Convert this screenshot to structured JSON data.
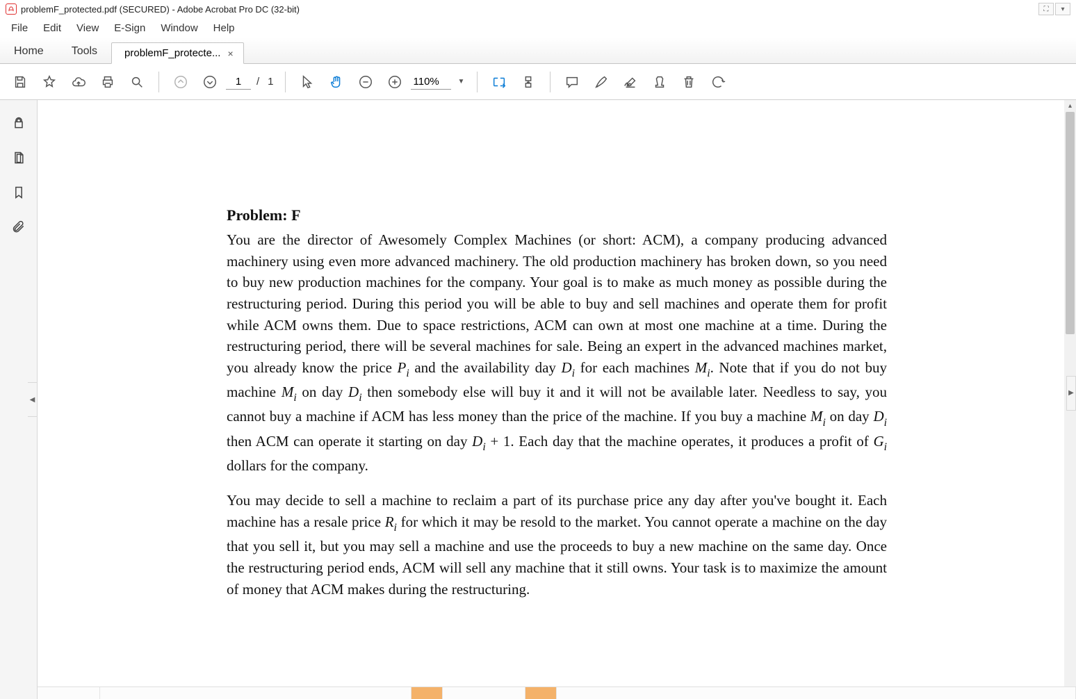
{
  "window": {
    "title": "problemF_protected.pdf (SECURED) - Adobe Acrobat Pro DC (32-bit)"
  },
  "menu": {
    "file": "File",
    "edit": "Edit",
    "view": "View",
    "esign": "E-Sign",
    "window": "Window",
    "help": "Help"
  },
  "tabs": {
    "home": "Home",
    "tools": "Tools",
    "doc": "problemF_protecte...",
    "close": "×"
  },
  "toolbar": {
    "page_current": "1",
    "page_sep": "/",
    "page_total": "1",
    "zoom_value": "110%"
  },
  "document": {
    "heading": "Problem: F",
    "para1_pre": "You are the director of Awesomely Complex Machines (or short: ACM), a company producing advanced machinery using even more advanced machinery. The old production machinery has broken down, so you need to buy new production machines for the company. Your goal is to make as much money as possible during the restructuring period. During this period you will be able to buy and sell machines and operate them for profit while ACM owns them. Due to space restrictions, ACM can own at most one machine at a time. During the restructuring period, there will be several machines for sale. Being an expert in the advanced machines market, you already know the price ",
    "para1_mid1": " and the availability day ",
    "para1_mid2": " for each machines ",
    "para1_mid3": ". Note that if you do not buy machine ",
    "para1_mid4": " on day ",
    "para1_mid5": " then somebody else will buy it and it will not be available later. Needless to say, you cannot buy a machine if ACM has less money than the price of the machine. If you buy a machine ",
    "para1_mid6": " on day ",
    "para1_mid7": " then ACM can operate it starting on day ",
    "para1_mid8": " + 1. Each day that the machine operates, it produces a profit of ",
    "para1_end": " dollars for the company.",
    "para2_pre": "You may decide to sell a machine to reclaim a part of its purchase price any day after you've bought it. Each machine has a resale price ",
    "para2_end": " for which it may be resold to the market. You cannot operate a machine on the day that you sell it, but you may sell a machine and use the proceeds to buy a new machine on the same day. Once the restructuring period ends, ACM will sell any machine that it still owns. Your task is to maximize the amount of money that ACM makes during the restructuring.",
    "var_P": "P",
    "var_D": "D",
    "var_M": "M",
    "var_G": "G",
    "var_R": "R",
    "sub_i": "i"
  }
}
